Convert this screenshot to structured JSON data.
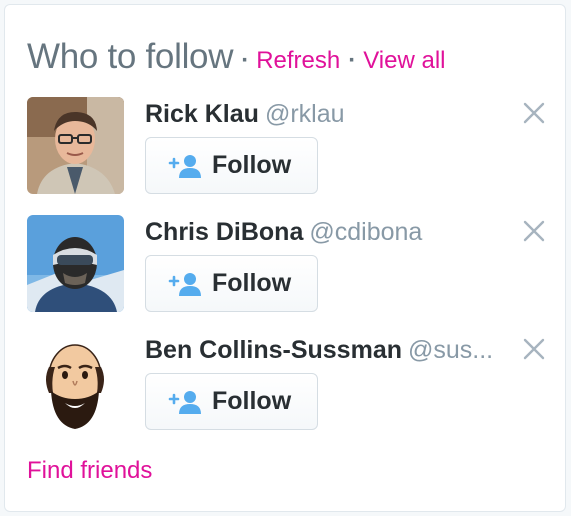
{
  "module": {
    "title": "Who to follow",
    "separator": "·",
    "refresh_label": "Refresh",
    "view_all_label": "View all",
    "find_friends_label": "Find friends"
  },
  "users": [
    {
      "name": "Rick Klau",
      "handle": "@rklau",
      "follow_label": "Follow"
    },
    {
      "name": "Chris DiBona",
      "handle": "@cdibona",
      "follow_label": "Follow"
    },
    {
      "name": "Ben Collins-Sussman",
      "handle": "@sus...",
      "follow_label": "Follow"
    }
  ],
  "icons": {
    "follow": "add-person-icon",
    "dismiss": "close-icon"
  },
  "colors": {
    "accent_link": "#e0119a",
    "follow_icon": "#55acee",
    "title_gray": "#66757f",
    "handle_gray": "#8899a6",
    "name_text": "#292f33"
  }
}
